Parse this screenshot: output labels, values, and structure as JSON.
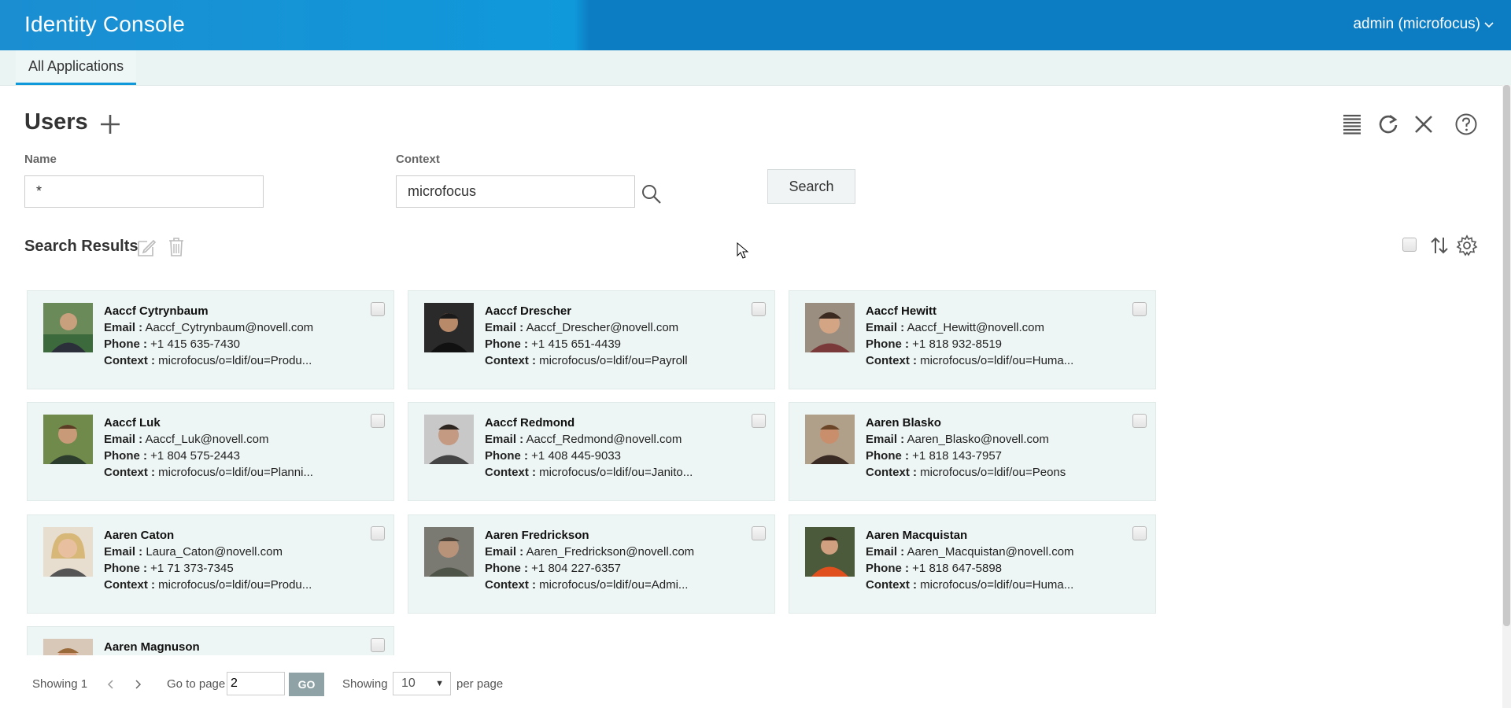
{
  "header": {
    "app_title": "Identity Console",
    "user_menu": "admin (microfocus)"
  },
  "tabs": [
    {
      "label": "All Applications"
    }
  ],
  "page": {
    "title": "Users"
  },
  "form": {
    "name_label": "Name",
    "name_value": "*",
    "context_label": "Context",
    "context_value": "microfocus",
    "search_button": "Search"
  },
  "results": {
    "title": "Search Results"
  },
  "labels": {
    "email": "Email :",
    "phone": "Phone :",
    "context": "Context :"
  },
  "users": [
    {
      "name": "Aaccf Cytrynbaum",
      "email": "Aaccf_Cytrynbaum@novell.com",
      "phone": "+1 415 635-7430",
      "context": "microfocus/o=ldif/ou=Produ..."
    },
    {
      "name": "Aaccf Drescher",
      "email": "Aaccf_Drescher@novell.com",
      "phone": "+1 415 651-4439",
      "context": "microfocus/o=ldif/ou=Payroll"
    },
    {
      "name": "Aaccf Hewitt",
      "email": "Aaccf_Hewitt@novell.com",
      "phone": "+1 818 932-8519",
      "context": "microfocus/o=ldif/ou=Huma..."
    },
    {
      "name": "Aaccf Luk",
      "email": "Aaccf_Luk@novell.com",
      "phone": "+1 804 575-2443",
      "context": "microfocus/o=ldif/ou=Planni..."
    },
    {
      "name": "Aaccf Redmond",
      "email": "Aaccf_Redmond@novell.com",
      "phone": "+1 408 445-9033",
      "context": "microfocus/o=ldif/ou=Janito..."
    },
    {
      "name": "Aaren Blasko",
      "email": "Aaren_Blasko@novell.com",
      "phone": "+1 818 143-7957",
      "context": "microfocus/o=ldif/ou=Peons"
    },
    {
      "name": "Aaren Caton",
      "email": "Laura_Caton@novell.com",
      "phone": "+1 71 373-7345",
      "context": "microfocus/o=ldif/ou=Produ..."
    },
    {
      "name": "Aaren Fredrickson",
      "email": "Aaren_Fredrickson@novell.com",
      "phone": "+1 804 227-6357",
      "context": "microfocus/o=ldif/ou=Admi..."
    },
    {
      "name": "Aaren Macquistan",
      "email": "Aaren_Macquistan@novell.com",
      "phone": "+1 818 647-5898",
      "context": "microfocus/o=ldif/ou=Huma..."
    },
    {
      "name": "Aaren Magnuson",
      "email": "",
      "phone": "",
      "context": ""
    }
  ],
  "pagination": {
    "showing_text": "Showing 1",
    "go_to_page_label": "Go to page",
    "page_value": "2",
    "go_button": "GO",
    "showing_label": "Showing",
    "per_page_value": "10",
    "per_page_suffix": "per page"
  },
  "colors": {
    "header": "#0d7dc3",
    "accent": "#0f99db",
    "card_bg": "#edf6f4",
    "go_button": "#8fa2a5"
  },
  "icons": {
    "add": "plus-icon",
    "list_view": "list-view-icon",
    "refresh": "refresh-icon",
    "close": "close-icon",
    "help": "help-icon",
    "search": "magnifier-icon",
    "edit": "edit-icon",
    "delete": "trash-icon",
    "sort": "sort-icon",
    "settings": "gear-icon"
  }
}
